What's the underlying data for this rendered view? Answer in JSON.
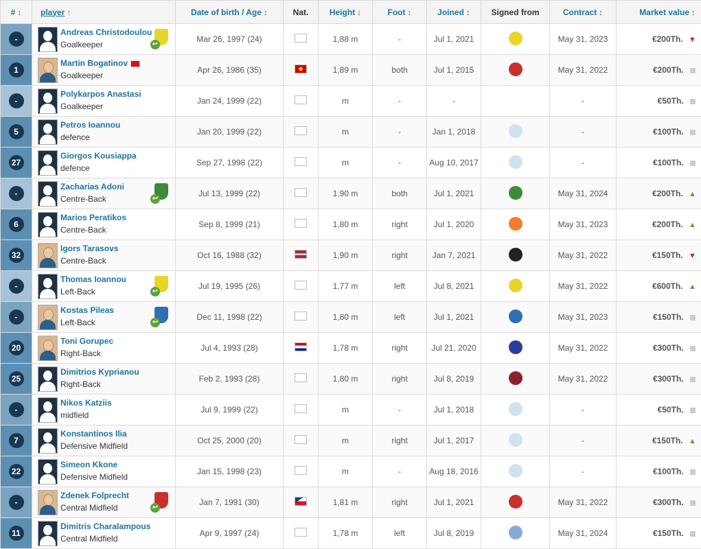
{
  "headers": {
    "num": "#",
    "player": "player",
    "dob": "Date of birth / Age",
    "nat": "Nat.",
    "height": "Height",
    "foot": "Foot",
    "joined": "Joined",
    "signed": "Signed from",
    "contract": "Contract",
    "value": "Market value"
  },
  "colors": {
    "accent": "#1d75a3",
    "numBg": "#5d8fb3",
    "circle": "#173752",
    "up": "#5ca13a",
    "down": "#c0262d"
  },
  "rows": [
    {
      "num": "-",
      "name": "Andreas Christodoulou",
      "pos": "Goalkeeper",
      "dob": "Mar 26, 1997 (24)",
      "height": "1,88 m",
      "foot": "-",
      "joined": "Jul 1, 2021",
      "contract": "May 31, 2023",
      "value": "€200Th.",
      "trend": "down",
      "nat": "cyprus",
      "club": "#e9d527",
      "loan": true,
      "photo": false,
      "signed": "#e9d527"
    },
    {
      "num": "1",
      "name": "Martin Bogatinov",
      "pos": "Goalkeeper",
      "dob": "Apr 26, 1986 (35)",
      "height": "1,89 m",
      "foot": "both",
      "joined": "Jul 1, 2015",
      "contract": "May 31, 2022",
      "value": "€200Th.",
      "trend": "none",
      "nat": "macedonia",
      "club": "",
      "loan": false,
      "photo": true,
      "signed": "#c9302c",
      "extraflag": "turkey"
    },
    {
      "num": "-",
      "name": "Polykarpos Anastasi",
      "pos": "Goalkeeper",
      "dob": "Jan 24, 1999 (22)",
      "height": "m",
      "foot": "-",
      "joined": "-",
      "contract": "-",
      "value": "€50Th.",
      "trend": "none",
      "nat": "cyprus",
      "club": "",
      "loan": false,
      "photo": false,
      "signed": ""
    },
    {
      "num": "5",
      "name": "Petros Ioannou",
      "pos": "defence",
      "dob": "Jan 20, 1999 (22)",
      "height": "m",
      "foot": "-",
      "joined": "Jan 1, 2018",
      "contract": "-",
      "value": "€100Th.",
      "trend": "none",
      "nat": "cyprus",
      "club": "",
      "loan": false,
      "photo": false,
      "signed": "#cfe3ee"
    },
    {
      "num": "27",
      "name": "Giorgos Kousiappa",
      "pos": "defence",
      "dob": "Sep 27, 1998 (22)",
      "height": "m",
      "foot": "-",
      "joined": "Aug 10, 2017",
      "contract": "-",
      "value": "€100Th.",
      "trend": "none",
      "nat": "cyprus",
      "club": "",
      "loan": false,
      "photo": false,
      "signed": "#cfe3ee"
    },
    {
      "num": "-",
      "name": "Zacharias Adoni",
      "pos": "Centre-Back",
      "dob": "Jul 13, 1999 (22)",
      "height": "1,90 m",
      "foot": "both",
      "joined": "Jul 1, 2021",
      "contract": "May 31, 2024",
      "value": "€200Th.",
      "trend": "up",
      "nat": "cyprus",
      "club": "#3c8a3a",
      "loan": true,
      "photo": false,
      "signed": "#3c8a3a"
    },
    {
      "num": "6",
      "name": "Marios Peratikos",
      "pos": "Centre-Back",
      "dob": "Sep 8, 1999 (21)",
      "height": "1,80 m",
      "foot": "right",
      "joined": "Jul 1, 2020",
      "contract": "May 31, 2023",
      "value": "€200Th.",
      "trend": "up",
      "nat": "cyprus",
      "club": "",
      "loan": false,
      "photo": false,
      "signed": "#ef7f2c"
    },
    {
      "num": "32",
      "name": "Igors Tarasovs",
      "pos": "Centre-Back",
      "dob": "Oct 16, 1988 (32)",
      "height": "1,90 m",
      "foot": "right",
      "joined": "Jan 7, 2021",
      "contract": "May 31, 2022",
      "value": "€150Th.",
      "trend": "down",
      "nat": "latvia",
      "club": "",
      "loan": false,
      "photo": true,
      "signed": "#222222"
    },
    {
      "num": "-",
      "name": "Thomas Ioannou",
      "pos": "Left-Back",
      "dob": "Jul 19, 1995 (26)",
      "height": "1,77 m",
      "foot": "left",
      "joined": "Jul 8, 2021",
      "contract": "May 31, 2022",
      "value": "€600Th.",
      "trend": "up",
      "nat": "cyprus",
      "club": "#e9d527",
      "loan": true,
      "photo": false,
      "signed": "#e9d527"
    },
    {
      "num": "-",
      "name": "Kostas Pileas",
      "pos": "Left-Back",
      "dob": "Dec 11, 1998 (22)",
      "height": "1,80 m",
      "foot": "left",
      "joined": "Jul 1, 2021",
      "contract": "May 31, 2023",
      "value": "€150Th.",
      "trend": "none",
      "nat": "cyprus",
      "club": "#2f6fb3",
      "loan": true,
      "photo": true,
      "signed": "#2f6fb3"
    },
    {
      "num": "20",
      "name": "Toni Gorupec",
      "pos": "Right-Back",
      "dob": "Jul 4, 1993 (28)",
      "height": "1,78 m",
      "foot": "right",
      "joined": "Jul 21, 2020",
      "contract": "May 31, 2022",
      "value": "€300Th.",
      "trend": "none",
      "nat": "croatia",
      "club": "",
      "loan": false,
      "photo": true,
      "signed": "#2c3c9a"
    },
    {
      "num": "25",
      "name": "Dimitrios Kyprianou",
      "pos": "Right-Back",
      "dob": "Feb 2, 1993 (28)",
      "height": "1,80 m",
      "foot": "right",
      "joined": "Jul 8, 2019",
      "contract": "May 31, 2022",
      "value": "€300Th.",
      "trend": "none",
      "nat": "cyprus",
      "club": "",
      "loan": false,
      "photo": false,
      "signed": "#8a2232"
    },
    {
      "num": "-",
      "name": "Nikos Katziis",
      "pos": "midfield",
      "dob": "Jul 9, 1999 (22)",
      "height": "m",
      "foot": "-",
      "joined": "Jul 1, 2018",
      "contract": "-",
      "value": "€50Th.",
      "trend": "none",
      "nat": "cyprus",
      "club": "",
      "loan": false,
      "photo": false,
      "signed": "#cfe3ee"
    },
    {
      "num": "7",
      "name": "Konstantinos Ilia",
      "pos": "Defensive Midfield",
      "dob": "Oct 25, 2000 (20)",
      "height": "m",
      "foot": "right",
      "joined": "Jul 1, 2017",
      "contract": "-",
      "value": "€150Th.",
      "trend": "up",
      "nat": "cyprus",
      "club": "",
      "loan": false,
      "photo": false,
      "signed": "#cfe3ee"
    },
    {
      "num": "22",
      "name": "Simeon Kkone",
      "pos": "Defensive Midfield",
      "dob": "Jan 15, 1998 (23)",
      "height": "m",
      "foot": "-",
      "joined": "Aug 18, 2016",
      "contract": "-",
      "value": "€100Th.",
      "trend": "none",
      "nat": "cyprus",
      "club": "",
      "loan": false,
      "photo": false,
      "signed": "#cfe3ee"
    },
    {
      "num": "-",
      "name": "Zdenek Folprecht",
      "pos": "Central Midfield",
      "dob": "Jan 7, 1991 (30)",
      "height": "1,81 m",
      "foot": "right",
      "joined": "Jul 1, 2021",
      "contract": "May 31, 2022",
      "value": "€300Th.",
      "trend": "none",
      "nat": "czech",
      "club": "#c9302c",
      "loan": true,
      "photo": true,
      "signed": "#c9302c"
    },
    {
      "num": "11",
      "name": "Dimitris Charalampous",
      "pos": "Central Midfield",
      "dob": "Apr 9, 1997 (24)",
      "height": "1,78 m",
      "foot": "left",
      "joined": "Jul 8, 2019",
      "contract": "May 31, 2024",
      "value": "€150Th.",
      "trend": "none",
      "nat": "cyprus",
      "club": "",
      "loan": false,
      "photo": false,
      "signed": "#8aa8d6"
    }
  ]
}
